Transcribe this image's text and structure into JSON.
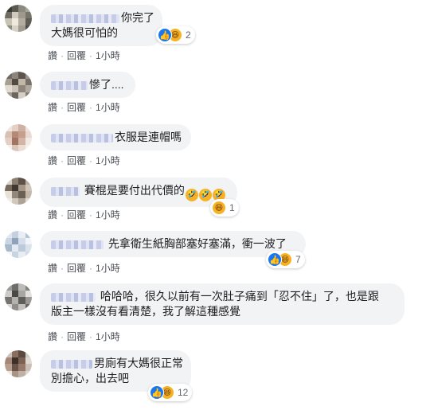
{
  "actions": {
    "like": "讚",
    "reply": "回覆",
    "time": "1小時",
    "dot": "·"
  },
  "comments": [
    {
      "name": "",
      "lines": [
        "你完了",
        "大媽很可怕的"
      ],
      "reactions": {
        "types": [
          "like-icon",
          "haha-icon"
        ],
        "count": "2"
      }
    },
    {
      "name": "",
      "lines": [
        "慘了...."
      ],
      "reactions": null
    },
    {
      "name": "",
      "lines": [
        "衣服是連帽嗎"
      ],
      "reactions": null
    },
    {
      "name": "",
      "lines": [
        "賽棍是要付出代價的"
      ],
      "emoji_suffix": "🤣🤣🤣",
      "reactions": {
        "types": [
          "haha-icon"
        ],
        "count": "1"
      }
    },
    {
      "name": "",
      "lines": [
        "先拿衛生紙胸部塞好塞滿，衝一波了"
      ],
      "reactions": {
        "types": [
          "like-icon",
          "haha-icon"
        ],
        "count": "7"
      }
    },
    {
      "name": "",
      "lines": [
        "哈哈哈，很久以前有一次肚子痛到「忍不住」了，也是跟",
        "版主一樣沒有看清楚，我了解這種感覺"
      ],
      "reactions": null
    },
    {
      "name": "",
      "lines": [
        "男廁有大媽很正常",
        "別擔心，出去吧"
      ],
      "reactions": {
        "types": [
          "like-icon",
          "haha-icon"
        ],
        "count": "12"
      }
    }
  ],
  "colors": {
    "bubble": "#f2f3f5",
    "like_blue": "#1877f2",
    "haha_yellow": "#f7b125",
    "meta_gray": "#606770"
  }
}
